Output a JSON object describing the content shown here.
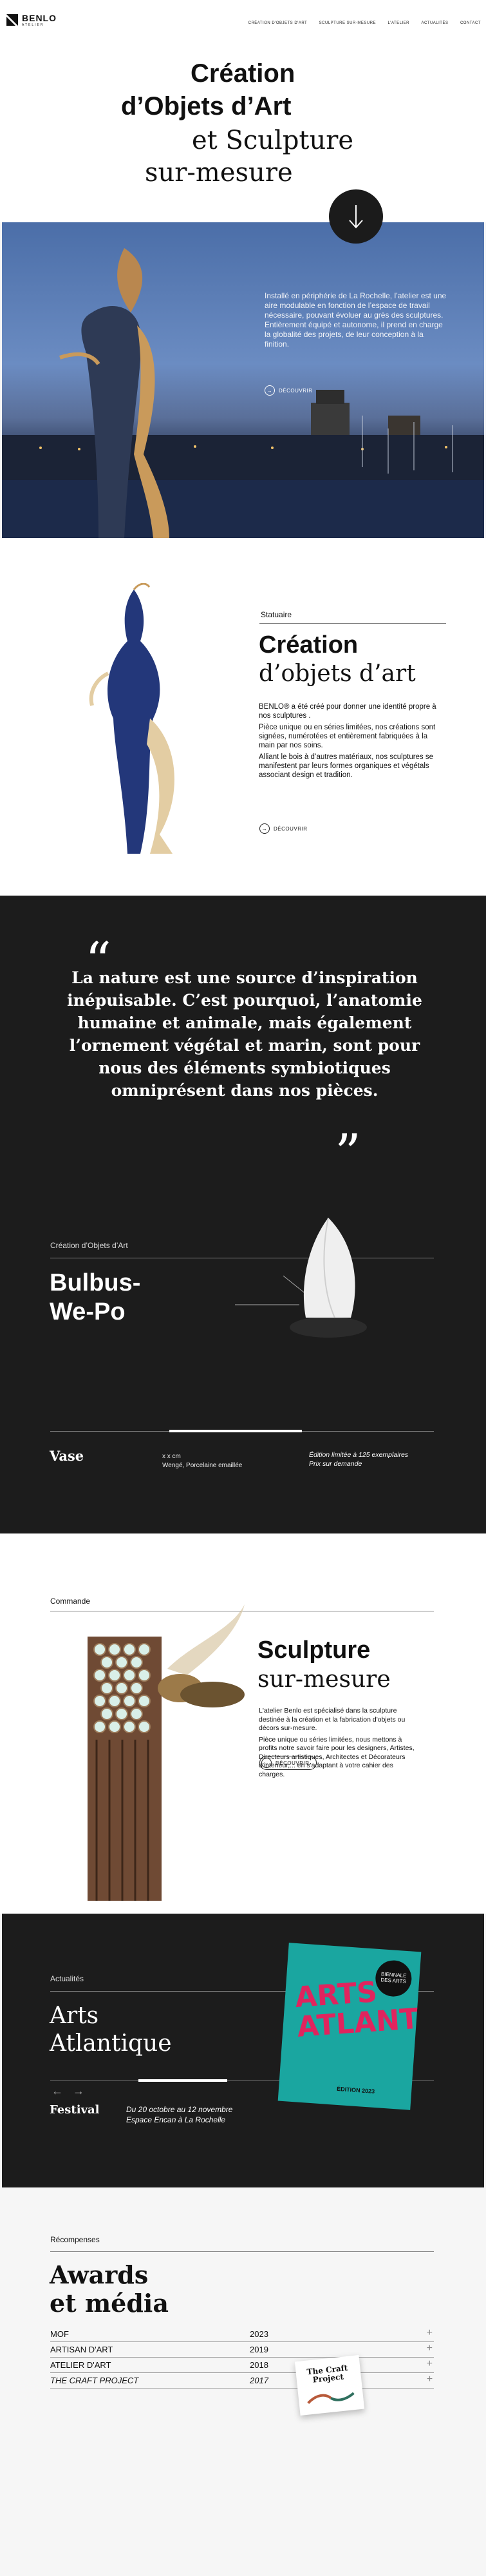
{
  "header": {
    "logo_text": "BENLO",
    "logo_sub": "ATELIER",
    "nav": [
      "CRÉATION D'OBJETS D'ART",
      "SCULPTURE SUR-MESURE",
      "L'ATELIER",
      "ACTUALITÉS",
      "CONTACT"
    ]
  },
  "hero": {
    "title_line1": "Création",
    "title_line2": "d’Objets d’Art",
    "title_line3": "et Sculpture",
    "title_line4": "sur-mesure",
    "text": "Installé en périphérie de La Rochelle, l’atelier est une aire modulable en fonction de l’espace de travail nécessaire, pouvant évoluer au grès des sculptures. Entièrement équipé et autonome, il prend en charge la globalité des projets, de leur conception à la finition.",
    "cta": "DÉCOUVRIR"
  },
  "statuaire": {
    "label": "Statuaire",
    "title_line1": "Création",
    "title_line2": "d’objets d’art",
    "para1": "BENLO® a été créé pour donner une identité propre à nos sculptures .",
    "para2": "Pièce unique ou en séries limitées, nos créations sont signées, numérotées et entièrement fabriquées à la main par nos soins.",
    "para3": "Alliant le bois à d’autres matériaux, nos sculptures se manifestent par leurs formes organiques et végétals associant design et tradition.",
    "cta": "DÉCOUVRIR"
  },
  "quote": {
    "text": "La nature est une source d’inspiration inépuisable. C’est pourquoi, l’anatomie humaine et animale, mais également l’ornement végétal et marin, sont pour nous des éléments symbiotiques omniprésent dans nos pièces.",
    "open": "“",
    "close": "”"
  },
  "product": {
    "label": "Création d’Objets d’Art",
    "title_line1": "Bulbus-",
    "title_line2": "We-Po",
    "category": "Vase",
    "size": "x x cm",
    "material": "Wengé, Porcelaine emaillée",
    "edition": "Édition limitée à 125 exemplaires",
    "price": "Prix sur demande"
  },
  "commande": {
    "label": "Commande",
    "title_line1": "Sculpture",
    "title_line2": "sur-mesure",
    "para1": "L'atelier Benlo est spécialisé dans la sculpture destinée à la création et la fabrication d'objets ou décors sur-mesure.",
    "para2": "Pièce unique ou séries limitées, nous mettons à profits notre savoir faire pour les designers, Artistes, Directeurs artistiques, Architectes et Décorateurs d'interieur,... en s'adaptant à votre cahier des charges.",
    "cta": "DÉCOUVRIR"
  },
  "actualites": {
    "label": "Actualités",
    "title_line1": "Arts",
    "title_line2": "Atlantique",
    "event_type": "Festival",
    "dates": "Du 20 octobre au 12 novembre",
    "place": "Espace Encan à La Rochelle",
    "poster_title": "ARTS ATLANTIC",
    "poster_badge": "BIENNALE DES ARTS",
    "poster_bottom": "ÉDITION 2023"
  },
  "awards": {
    "label": "Récompenses",
    "title_line1": "Awards",
    "title_line2": "et média",
    "rows": [
      {
        "name": "MOF",
        "year": "2023"
      },
      {
        "name": "ARTISAN D'ART",
        "year": "2019"
      },
      {
        "name": "ATELIER D'ART",
        "year": "2018"
      },
      {
        "name": "THE CRAFT PROJECT",
        "year": "2017"
      }
    ],
    "card_title": "The Craft Project"
  },
  "colors": {
    "accent_dark": "#1c1c1c",
    "teal": "#1aa6a0",
    "magenta": "#e0245e",
    "sky": "#3f5f9a"
  }
}
